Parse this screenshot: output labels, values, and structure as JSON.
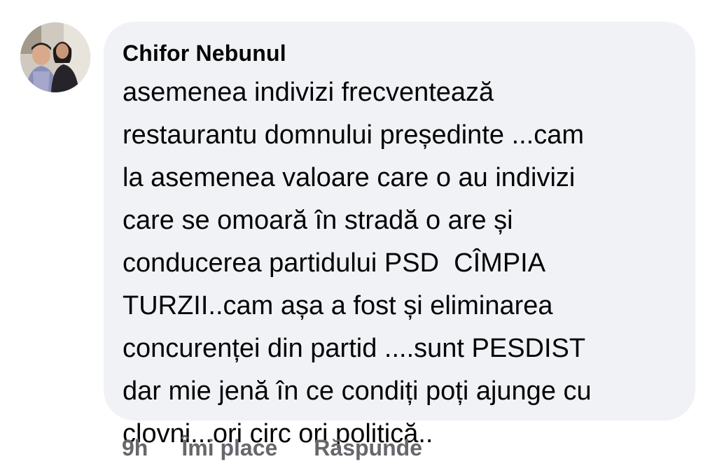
{
  "comment": {
    "author": "Chifor Nebunul",
    "avatar_icon": "profile-photo-avatar",
    "lines": [
      "asemenea indivizi frecventează",
      "restaurantu domnului președinte ...cam",
      "la asemenea valoare care o au indivizi",
      "care se omoară în stradă o are și",
      "conducerea partidului PSD  CÎMPIA",
      "TURZII..cam așa a fost și eliminarea",
      "concurenței din partid ....sunt PESDIST",
      "dar mie jenă în ce condiți poți ajunge cu",
      "clovni...ori circ ori politică.."
    ]
  },
  "actions": {
    "time": "9h",
    "like_label": "Îmi place",
    "reply_label": "Răspunde"
  },
  "colors": {
    "bubble_bg": "#f0f2f5",
    "text": "#050505",
    "secondary_text": "#65676b"
  }
}
